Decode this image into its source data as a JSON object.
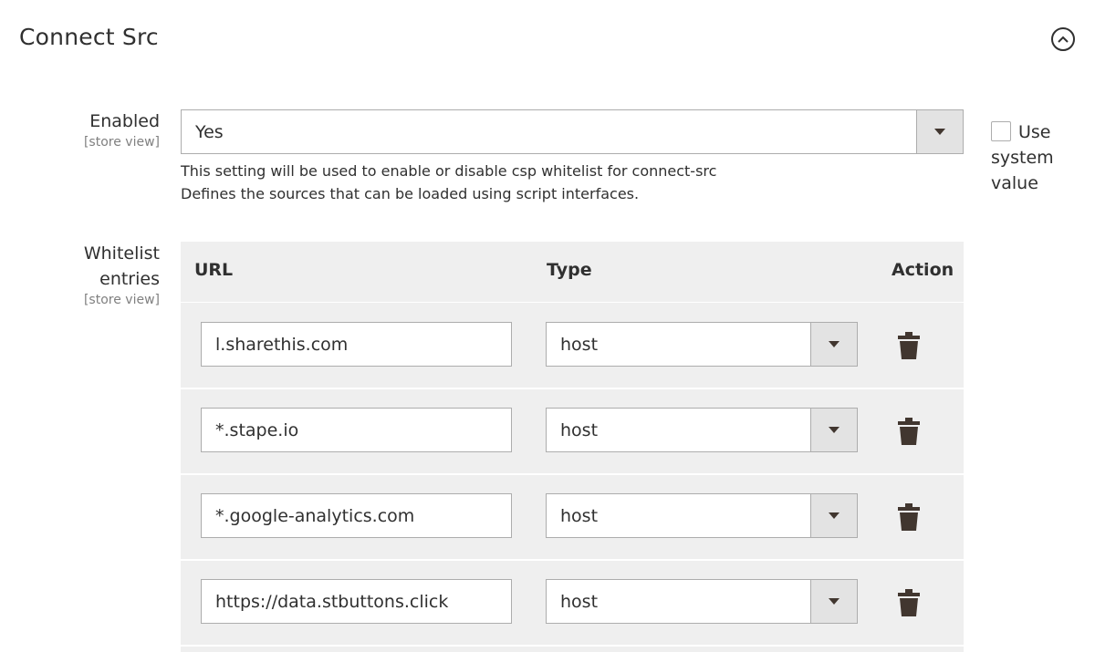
{
  "section": {
    "title": "Connect Src",
    "collapse_icon": "chevron-up-circle-icon"
  },
  "enabled": {
    "label": "Enabled",
    "scope": "[store view]",
    "value": "Yes",
    "note_line1": "This setting will be used to enable or disable csp whitelist for connect-src",
    "note_line2": "Defines the sources that can be loaded using script interfaces.",
    "use_system_value_label": "Use system value",
    "use_system_value_checked": false
  },
  "whitelist": {
    "label": "Whitelist entries",
    "scope": "[store view]",
    "columns": {
      "url": "URL",
      "type": "Type",
      "action": "Action"
    },
    "rows": [
      {
        "url": "l.sharethis.com",
        "type": "host",
        "action_icon": "trash-icon"
      },
      {
        "url": "*.stape.io",
        "type": "host",
        "action_icon": "trash-icon"
      },
      {
        "url": "*.google-analytics.com",
        "type": "host",
        "action_icon": "trash-icon"
      },
      {
        "url": "https://data.stbuttons.click",
        "type": "host",
        "action_icon": "trash-icon"
      }
    ]
  },
  "colors": {
    "text": "#303030",
    "muted": "#808080",
    "grid_bg": "#efefef",
    "border": "#adadad",
    "icon": "#41362f"
  }
}
